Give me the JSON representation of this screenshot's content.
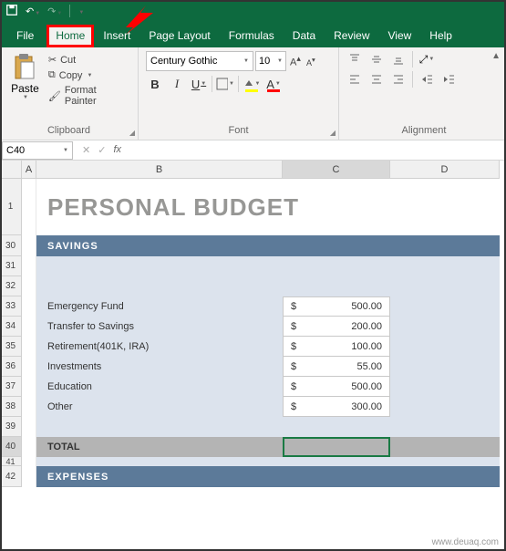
{
  "qat": {
    "save": "save-icon",
    "undo": "undo-icon",
    "redo": "redo-icon"
  },
  "tabs": {
    "file": "File",
    "items": [
      "Home",
      "Insert",
      "Page Layout",
      "Formulas",
      "Data",
      "Review",
      "View",
      "Help"
    ],
    "active": "Home"
  },
  "ribbon": {
    "clipboard": {
      "label": "Clipboard",
      "paste": "Paste",
      "cut": "Cut",
      "copy": "Copy",
      "painter": "Format Painter"
    },
    "font": {
      "label": "Font",
      "name": "Century Gothic",
      "size": "10"
    },
    "alignment": {
      "label": "Alignment"
    }
  },
  "namebox": "C40",
  "columns": [
    "A",
    "B",
    "C",
    "D"
  ],
  "rows": [
    "1",
    "30",
    "31",
    "32",
    "33",
    "34",
    "35",
    "36",
    "37",
    "38",
    "39",
    "40",
    "41",
    "42"
  ],
  "sheet": {
    "title": "PERSONAL BUDGET",
    "savings_header": "SAVINGS",
    "items": [
      {
        "label": "Emergency Fund",
        "currency": "$",
        "value": "500.00"
      },
      {
        "label": "Transfer to Savings",
        "currency": "$",
        "value": "200.00"
      },
      {
        "label": "Retirement(401K, IRA)",
        "currency": "$",
        "value": "100.00"
      },
      {
        "label": "Investments",
        "currency": "$",
        "value": "55.00"
      },
      {
        "label": "Education",
        "currency": "$",
        "value": "500.00"
      },
      {
        "label": "Other",
        "currency": "$",
        "value": "300.00"
      }
    ],
    "total_label": "TOTAL",
    "expenses_header": "EXPENSES"
  },
  "watermark": "www.deuaq.com"
}
